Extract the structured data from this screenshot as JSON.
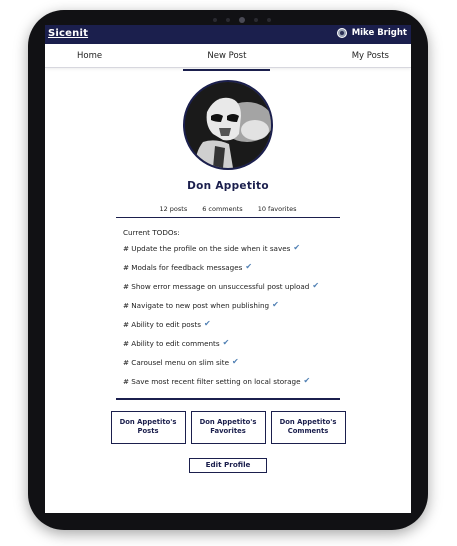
{
  "app": {
    "logo_text": "Sicenit",
    "user_name": "Mike Bright"
  },
  "nav": {
    "tabs": [
      "Home",
      "New Post",
      "My Posts"
    ],
    "active_tab": "New Post"
  },
  "profile": {
    "name": "Don Appetito",
    "stats": {
      "posts": "12 posts",
      "comments": "6 comments",
      "favorites": "10 favorites"
    }
  },
  "todos": {
    "heading": "Current TODOs:",
    "items": [
      "# Update the profile on the side when it saves",
      "# Modals for feedback messages",
      "# Show error message on unsuccessful post upload",
      "# Navigate to new post when publishing",
      "# Ability to edit posts",
      "# Ability to edit comments",
      "# Carousel menu on slim site",
      "# Save most recent filter setting on local storage"
    ],
    "check_mark": "✔"
  },
  "cards": {
    "posts": "Don Appetito's Posts",
    "favorites": "Don Appetito's Favorites",
    "comments": "Don Appetito's Comments"
  },
  "edit_profile_label": "Edit Profile",
  "colors": {
    "primary": "#1b1f4d",
    "check": "#4f7fb3"
  },
  "icons": {
    "user_avatar": "user-avatar-icon",
    "profile_avatar": "stormtrooper-avatar-image"
  }
}
